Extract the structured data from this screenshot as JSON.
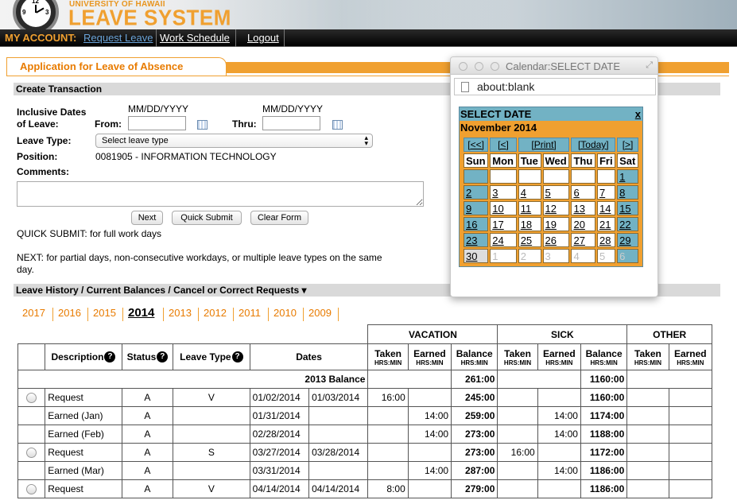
{
  "brand": {
    "top": "UNIVERSITY OF HAWAII",
    "main": "LEAVE SYSTEM",
    "clock_numbers": [
      "12",
      "9",
      "3"
    ]
  },
  "nav": {
    "account_label": "MY ACCOUNT:",
    "links": [
      "Request Leave",
      "Work Schedule",
      "Logout"
    ]
  },
  "app_title": "Application for Leave of Absence",
  "create": {
    "section_title": "Create Transaction",
    "dates_label_1": "Inclusive Dates",
    "dates_label_2": "of Leave:",
    "date_format_from": "MM/DD/YYYY",
    "date_format_thru": "MM/DD/YYYY",
    "from_label": "From:",
    "thru_label": "Thru:",
    "from_value": "",
    "thru_value": "",
    "leave_type_label": "Leave Type:",
    "leave_type_value": "Select leave type",
    "position_label": "Position:",
    "position_value": "0081905 - INFORMATION TECHNOLOGY",
    "comments_label": "Comments:",
    "comments_value": "",
    "buttons": {
      "next": "Next",
      "quick_submit": "Quick Submit",
      "clear_form": "Clear Form"
    },
    "quick_note": "QUICK SUBMIT: for full work days",
    "next_note_1": "NEXT: for partial days, non-consecutive workdays, or multiple leave types on the same",
    "next_note_2": "day."
  },
  "history": {
    "section_title": "Leave History / Current Balances / Cancel or Correct Requests ▾",
    "years": [
      "2017",
      "2016",
      "2015",
      "2014",
      "2013",
      "2012",
      "2011",
      "2010",
      "2009"
    ],
    "current_year": "2014",
    "group_headers": {
      "vacation": "VACATION",
      "sick": "SICK",
      "other": "OTHER"
    },
    "col_headers": {
      "description": "Description",
      "status": "Status",
      "leave_type": "Leave Type",
      "dates": "Dates",
      "taken": "Taken",
      "earned": "Earned",
      "balance": "Balance",
      "unit": "HRS:MIN"
    },
    "balance_row": {
      "label": "2013 Balance",
      "vac_balance": "261:00",
      "sick_balance": "1160:00"
    },
    "rows": [
      {
        "radio": true,
        "desc": "Request",
        "status": "A",
        "type": "V",
        "date1": "01/02/2014",
        "date2": "01/03/2014",
        "vt": "16:00",
        "ve": "",
        "vb": "245:00",
        "st": "",
        "se": "",
        "sb": "1160:00"
      },
      {
        "radio": false,
        "desc": "Earned (Jan)",
        "status": "A",
        "type": "",
        "date1": "01/31/2014",
        "date2": "",
        "vt": "",
        "ve": "14:00",
        "vb": "259:00",
        "st": "",
        "se": "14:00",
        "sb": "1174:00"
      },
      {
        "radio": false,
        "desc": "Earned (Feb)",
        "status": "A",
        "type": "",
        "date1": "02/28/2014",
        "date2": "",
        "vt": "",
        "ve": "14:00",
        "vb": "273:00",
        "st": "",
        "se": "14:00",
        "sb": "1188:00"
      },
      {
        "radio": true,
        "desc": "Request",
        "status": "A",
        "type": "S",
        "date1": "03/27/2014",
        "date2": "03/28/2014",
        "vt": "",
        "ve": "",
        "vb": "273:00",
        "st": "16:00",
        "se": "",
        "sb": "1172:00"
      },
      {
        "radio": false,
        "desc": "Earned (Mar)",
        "status": "A",
        "type": "",
        "date1": "03/31/2014",
        "date2": "",
        "vt": "",
        "ve": "14:00",
        "vb": "287:00",
        "st": "",
        "se": "14:00",
        "sb": "1186:00"
      },
      {
        "radio": true,
        "desc": "Request",
        "status": "A",
        "type": "V",
        "date1": "04/14/2014",
        "date2": "04/14/2014",
        "vt": "8:00",
        "ve": "",
        "vb": "279:00",
        "st": "",
        "se": "",
        "sb": "1186:00"
      }
    ]
  },
  "popup": {
    "window_title": "Calendar:SELECT DATE",
    "url": "about:blank",
    "header": "SELECT DATE",
    "close": "x",
    "month": "November 2014",
    "nav": [
      "[<<]",
      "[<]",
      "[Print]",
      "[Today]",
      "[>]",
      "[>>]"
    ],
    "days": [
      "Sun",
      "Mon",
      "Tue",
      "Wed",
      "Thu",
      "Fri",
      "Sat"
    ],
    "weeks": [
      [
        "",
        "",
        "",
        "",
        "",
        "",
        "1"
      ],
      [
        "2",
        "3",
        "4",
        "5",
        "6",
        "7",
        "8"
      ],
      [
        "9",
        "10",
        "11",
        "12",
        "13",
        "14",
        "15"
      ],
      [
        "16",
        "17",
        "18",
        "19",
        "20",
        "21",
        "22"
      ],
      [
        "23",
        "24",
        "25",
        "26",
        "27",
        "28",
        "29"
      ],
      [
        "30",
        "1",
        "2",
        "3",
        "4",
        "5",
        "6"
      ]
    ]
  },
  "colors": {
    "accent_orange": "#f0a030",
    "calendar_blue": "#72b2c4",
    "nav_link_blue": "#6aa3d8"
  }
}
